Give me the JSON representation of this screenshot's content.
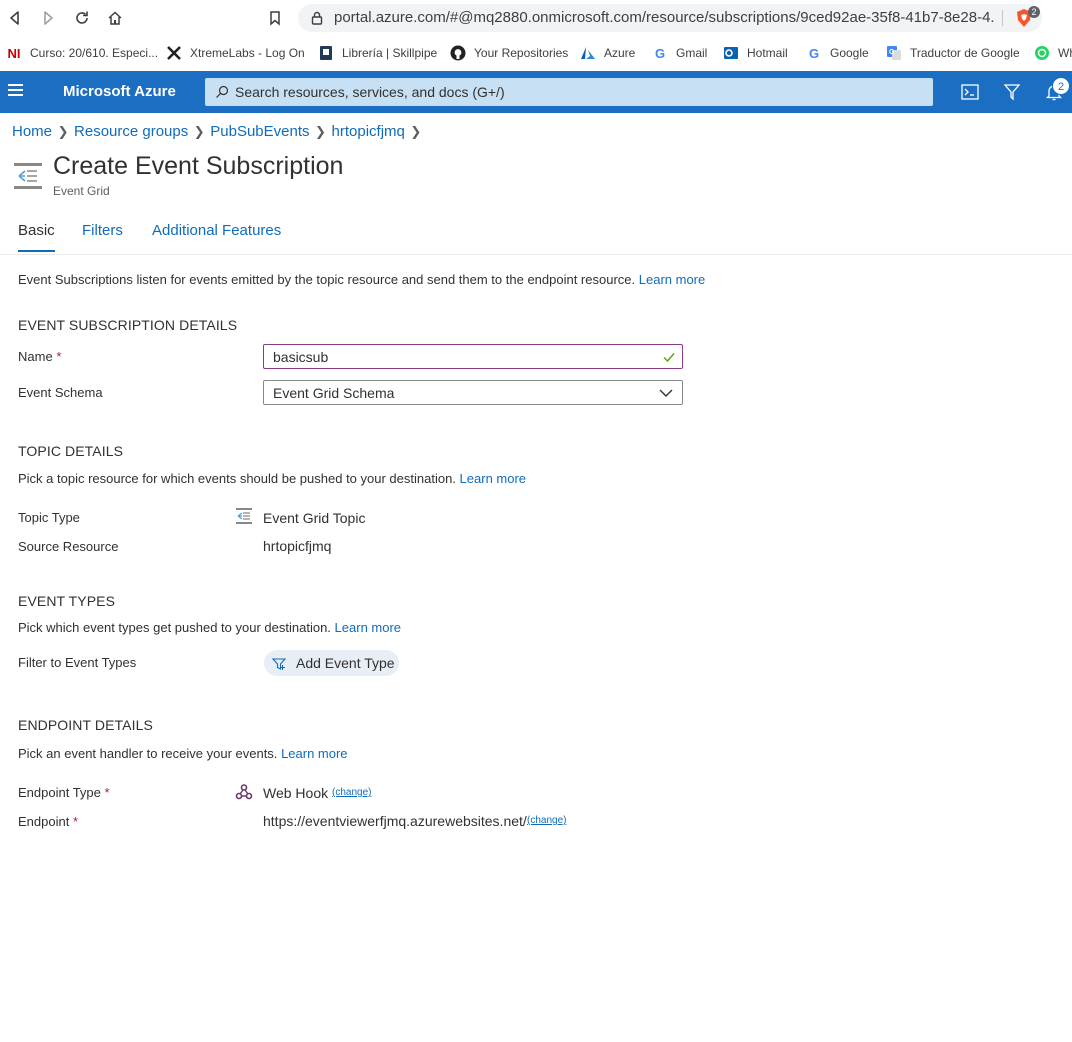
{
  "browser": {
    "url": "portal.azure.com/#@mq2880.onmicrosoft.com/resource/subscriptions/9ced92ae-35f8-41b7-8e28-4...",
    "shield_count": "2",
    "bookmarks": [
      {
        "label": "Curso: 20/610. Especi...",
        "icon": "ni-logo-icon"
      },
      {
        "label": "XtremeLabs - Log On",
        "icon": "xtremelabs-icon"
      },
      {
        "label": "Librería | Skillpipe",
        "icon": "book-icon"
      },
      {
        "label": "Your Repositories",
        "icon": "github-icon"
      },
      {
        "label": "Azure",
        "icon": "azure-icon"
      },
      {
        "label": "Gmail",
        "icon": "google-icon"
      },
      {
        "label": "Hotmail",
        "icon": "outlook-icon"
      },
      {
        "label": "Google",
        "icon": "google-icon"
      },
      {
        "label": "Traductor de Google",
        "icon": "translate-icon"
      },
      {
        "label": "Wh",
        "icon": "whatsapp-icon"
      }
    ]
  },
  "azure": {
    "brand": "Microsoft Azure",
    "search_placeholder": "Search resources, services, and docs (G+/)",
    "notification_count": "2"
  },
  "breadcrumb": [
    "Home",
    "Resource groups",
    "PubSubEvents",
    "hrtopicfjmq"
  ],
  "page": {
    "title": "Create Event Subscription",
    "subtitle": "Event Grid"
  },
  "tabs": [
    "Basic",
    "Filters",
    "Additional Features"
  ],
  "intro": {
    "text": "Event Subscriptions listen for events emitted by the topic resource and send them to the endpoint resource.",
    "learn_more": "Learn more"
  },
  "subscription_details": {
    "heading": "EVENT SUBSCRIPTION DETAILS",
    "name_label": "Name",
    "name_value": "basicsub",
    "schema_label": "Event Schema",
    "schema_value": "Event Grid Schema"
  },
  "topic_details": {
    "heading": "TOPIC DETAILS",
    "desc": "Pick a topic resource for which events should be pushed to your destination.",
    "learn_more": "Learn more",
    "type_label": "Topic Type",
    "type_value": "Event Grid Topic",
    "source_label": "Source Resource",
    "source_value": "hrtopicfjmq"
  },
  "event_types": {
    "heading": "EVENT TYPES",
    "desc": "Pick which event types get pushed to your destination.",
    "learn_more": "Learn more",
    "filter_label": "Filter to Event Types",
    "add_button": "Add Event Type"
  },
  "endpoint_details": {
    "heading": "ENDPOINT DETAILS",
    "desc": "Pick an event handler to receive your events.",
    "learn_more": "Learn more",
    "type_label": "Endpoint Type",
    "type_value": "Web Hook",
    "endpoint_label": "Endpoint",
    "endpoint_value": "https://eventviewerfjmq.azurewebsites.net/",
    "change": "(change)"
  },
  "required_marker": "*",
  "colors": {
    "azure_bar": "#1b6ec2",
    "link": "#0f6cbd",
    "required": "#a4262c",
    "valid": "#57a300"
  }
}
